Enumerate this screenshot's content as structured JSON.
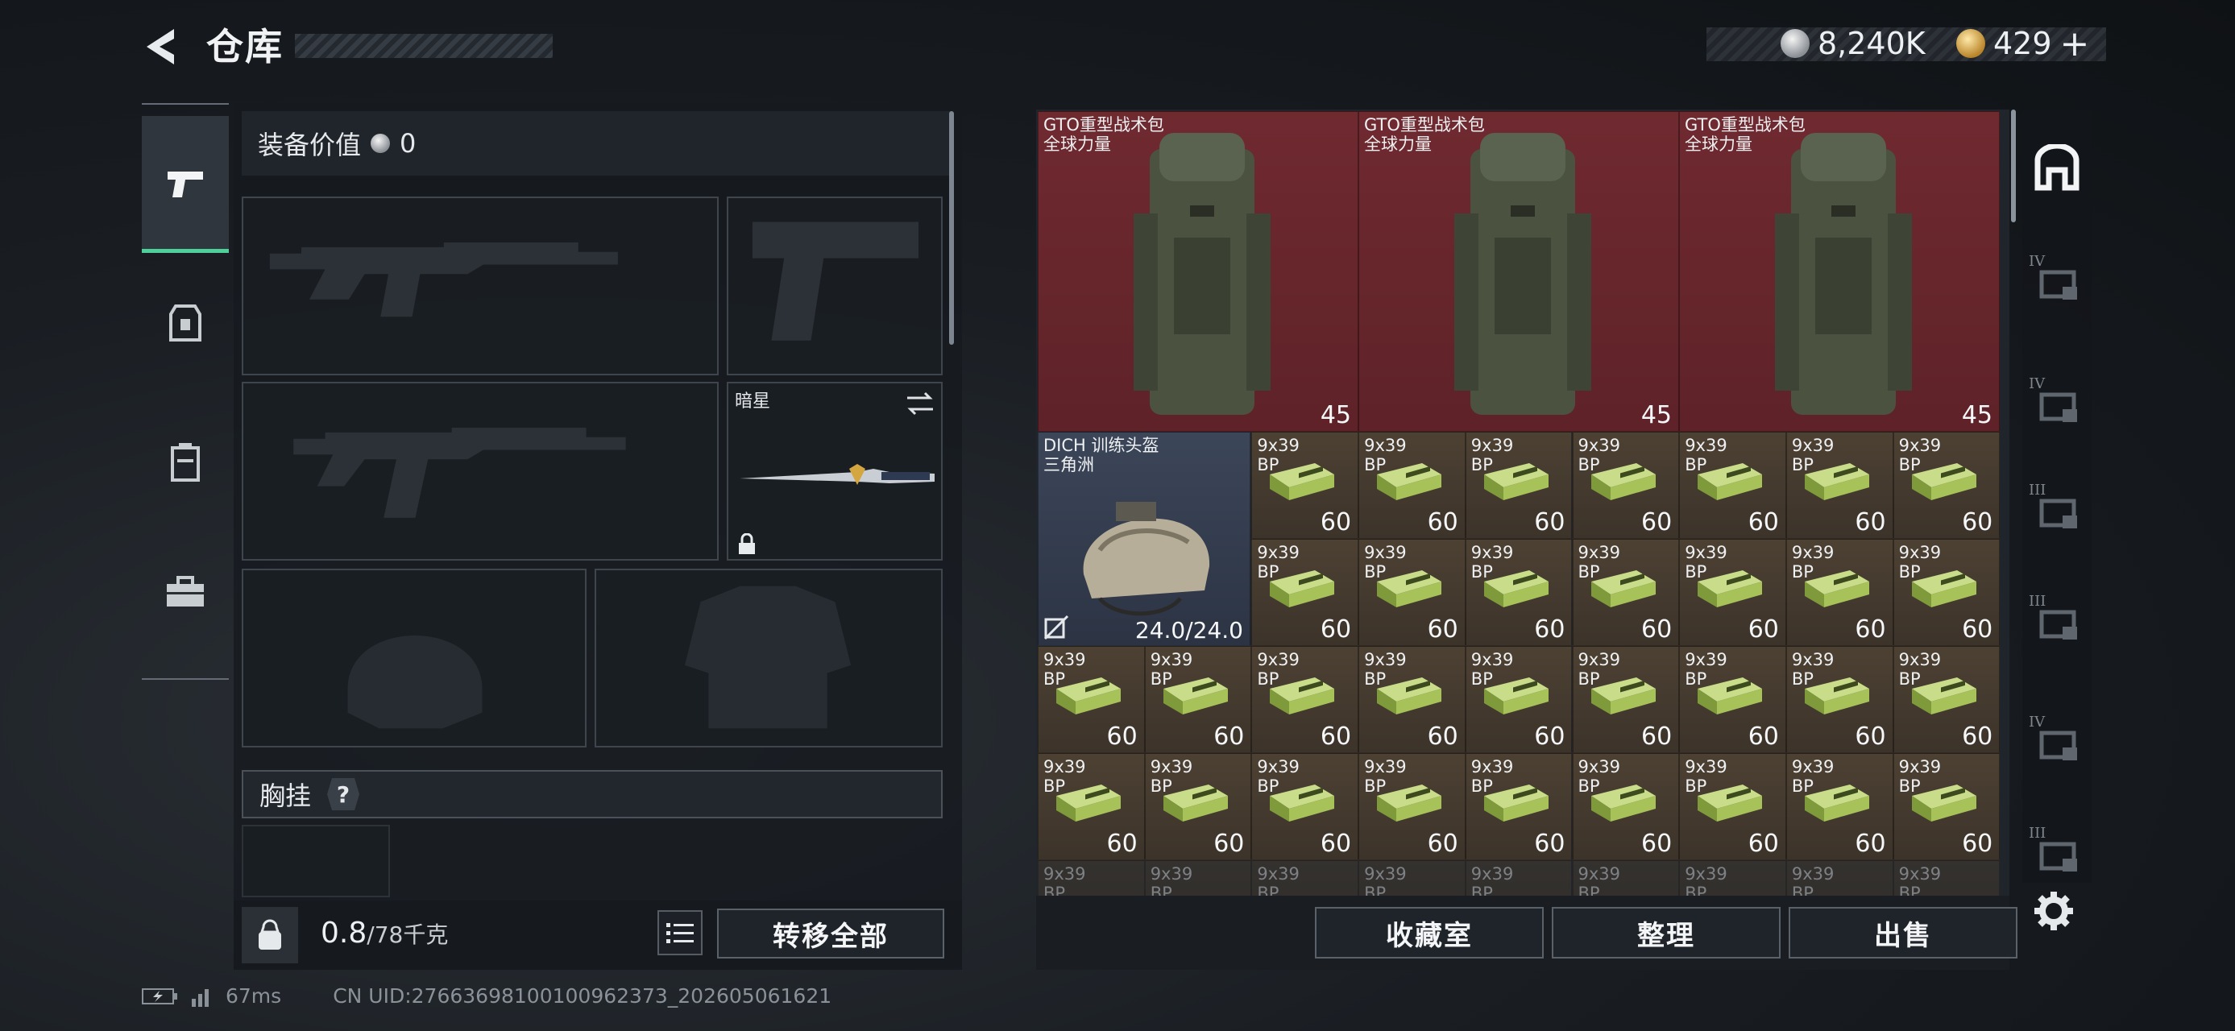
{
  "header": {
    "title": "仓库"
  },
  "currency": {
    "silver": "8,240K",
    "gold": "429",
    "gold_plus": "+"
  },
  "equipment": {
    "value_label": "装备价值",
    "value": "0",
    "melee_label": "暗星",
    "chest_rig_label": "胸挂",
    "chest_rig_help": "?",
    "weight": "0.8",
    "weight_max": "/78千克",
    "transfer_all": "转移全部"
  },
  "stash": {
    "backpacks": [
      {
        "name": "GTO重型战术包\n全球力量",
        "qty": "45"
      },
      {
        "name": "GTO重型战术包\n全球力量",
        "qty": "45"
      },
      {
        "name": "GTO重型战术包\n全球力量",
        "qty": "45"
      }
    ],
    "helmet": {
      "name": "DICH 训练头盔\n三角洲",
      "durability": "24.0/24.0"
    },
    "ammo_name": "9x39\nBP",
    "ammo_qty": "60",
    "buttons": {
      "collection": "收藏室",
      "sort": "整理",
      "sell": "出售"
    }
  },
  "side_filters": [
    "IV",
    "IV",
    "III",
    "III",
    "IV",
    "III"
  ],
  "status": {
    "ping": "67ms",
    "uid": "CN UID:27663698100100962373_202605061621"
  },
  "colors": {
    "accent_green": "#4fcf9a",
    "backpack_bg": "#6f2a30",
    "ammo_bg": "#4d4133",
    "helmet_bg": "#3c4659"
  }
}
